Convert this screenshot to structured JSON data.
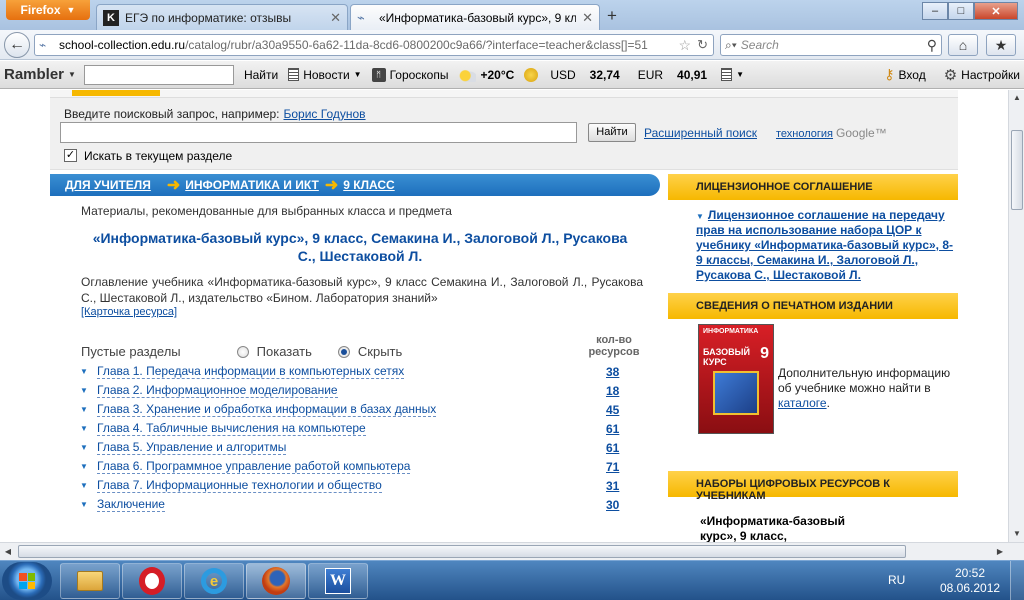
{
  "browser": {
    "app_button": "Firefox",
    "tabs": [
      {
        "title": "ЕГЭ по информатике: отзывы",
        "active": false
      },
      {
        "title": "«Информатика-базовый курс», 9 кл...",
        "active": true
      }
    ],
    "url_host": "school-collection.edu.ru",
    "url_path": "/catalog/rubr/a30a9550-6a62-11da-8cd6-0800200c9a66/?interface=teacher&class[]=51",
    "search_placeholder": "Search"
  },
  "rambler": {
    "logo": "Rambler",
    "find": "Найти",
    "news": "Новости",
    "horoscopes": "Гороскопы",
    "temperature": "+20°C",
    "usd_label": "USD",
    "usd_value": "32,74",
    "eur_label": "EUR",
    "eur_value": "40,91",
    "login": "Вход",
    "settings": "Настройки"
  },
  "search": {
    "hint": "Введите поисковый запрос, например:",
    "hint_example": "Борис Годунов",
    "button": "Найти",
    "advanced": "Расширенный поиск",
    "tech": "технология",
    "google": "Google™",
    "checkbox_label": "Искать в текущем разделе"
  },
  "breadcrumb": [
    "ДЛЯ УЧИТЕЛЯ",
    "ИНФОРМАТИКА И ИКТ",
    "9 КЛАСС"
  ],
  "main": {
    "subtitle": "Материалы, рекомендованные для выбранных класса и предмета",
    "title": "«Информатика-базовый курс», 9 класс, Семакина И., Залоговой Л., Русакова С., Шестаковой Л.",
    "description": "Оглавление учебника «Информатика-базовый курс», 9 класс Семакина И., Залоговой Л., Русакова С., Шестаковой Л., издательство «Бином. Лаборатория знаний»",
    "card_link": "[Карточка ресурса]",
    "empty_sections": "Пустые разделы",
    "show": "Показать",
    "hide": "Скрыть",
    "count_header_1": "кол-во",
    "count_header_2": "ресурсов",
    "chapters": [
      {
        "title": "Глава 1. Передача информации в компьютерных сетях",
        "count": "38"
      },
      {
        "title": "Глава 2. Информационное моделирование",
        "count": "18"
      },
      {
        "title": "Глава 3. Хранение и обработка информации в базах данных",
        "count": "45"
      },
      {
        "title": "Глава 4. Табличные вычисления на компьютере",
        "count": "61"
      },
      {
        "title": "Глава 5. Управление и алгоритмы",
        "count": "61"
      },
      {
        "title": "Глава 6. Программное управление работой компьютера",
        "count": "71"
      },
      {
        "title": "Глава 7. Информационные технологии и общество",
        "count": "31"
      },
      {
        "title": "Заключение",
        "count": "30"
      }
    ]
  },
  "side": {
    "license_head": "ЛИЦЕНЗИОННОЕ СОГЛАШЕНИЕ",
    "license_link": "Лицензионное соглашение на передачу прав на использование набора ЦОР к учебнику «Информатика-базовый курс», 8-9 классы, Семакина И., Залоговой Л., Русакова С., Шестаковой Л.",
    "print_head": "СВЕДЕНИЯ О ПЕЧАТНОМ ИЗДАНИИ",
    "book_title_1": "ИНФОРМАТИКА",
    "book_title_2": "БАЗОВЫЙ КУРС",
    "book_number": "9",
    "print_text": "Дополнительную информацию об учебнике можно найти в",
    "print_link": "каталоге",
    "print_dot": ".",
    "sets_head": "НАБОРЫ ЦИФРОВЫХ РЕСУРСОВ К УЧЕБНИКАМ",
    "sets_item": "«Информатика-базовый курс», 9 класс,"
  },
  "taskbar": {
    "lang": "RU",
    "time": "20:52",
    "date": "08.06.2012"
  },
  "colors": {
    "link_blue": "#0d4ea0",
    "accent_yellow": "#f6b800",
    "crumb_blue": "#1d6fbd"
  }
}
